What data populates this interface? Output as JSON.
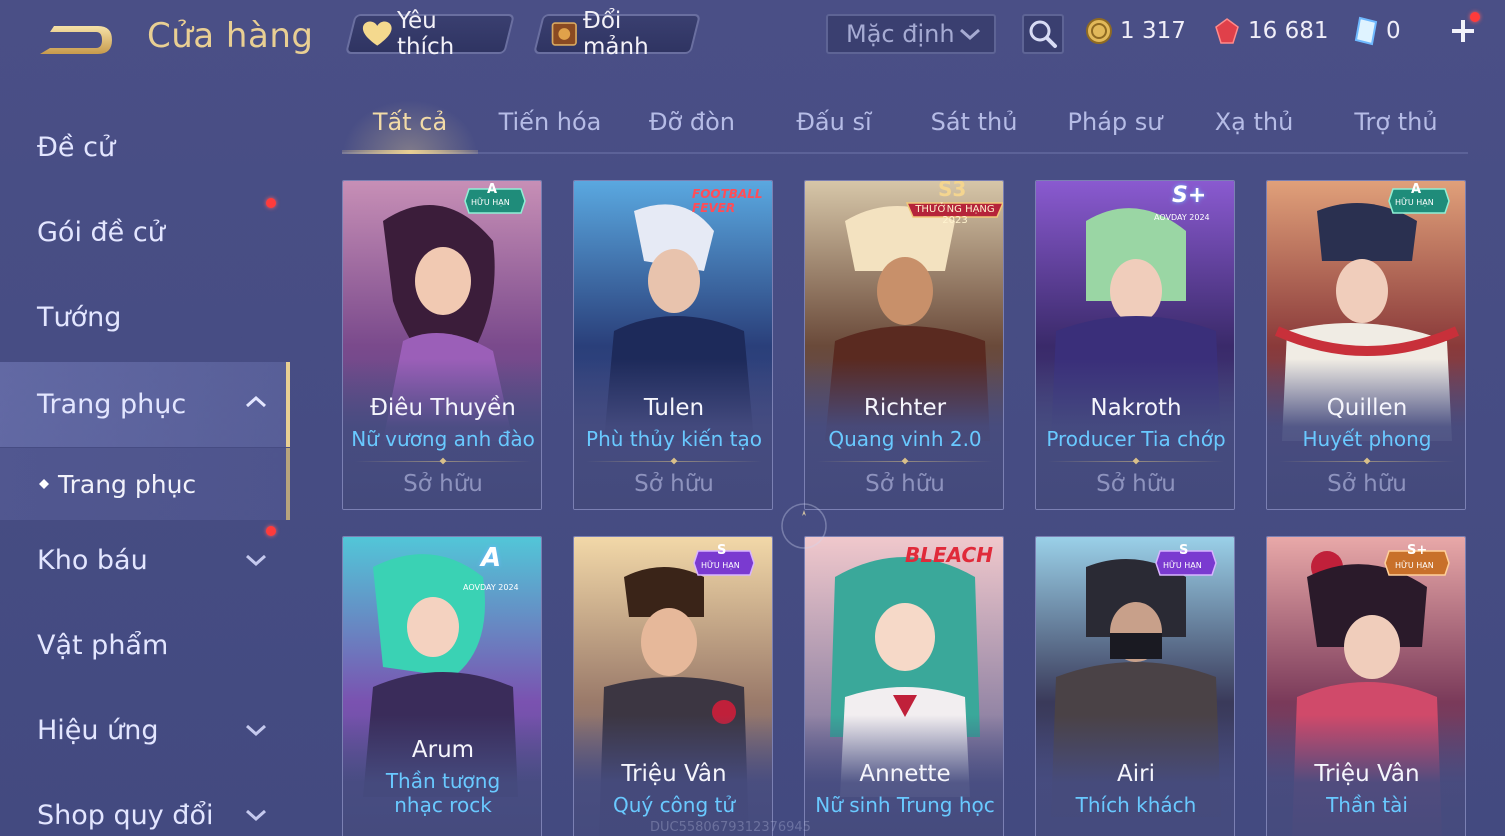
{
  "header": {
    "title": "Cửa hàng",
    "favorites_label": "Yêu thích",
    "fragments_label": "Đổi mảnh",
    "sort_label": "Mặc định"
  },
  "currency": {
    "coins": "1 317",
    "gems": "16 681",
    "vouchers": "0"
  },
  "sidebar": {
    "items": [
      {
        "label": "Đề cử"
      },
      {
        "label": "Gói đề cử"
      },
      {
        "label": "Tướng"
      },
      {
        "label": "Trang phục"
      },
      {
        "label": "Kho báu"
      },
      {
        "label": "Vật phẩm"
      },
      {
        "label": "Hiệu ứng"
      },
      {
        "label": "Shop quy đổi"
      }
    ],
    "sub_item": "Trang phục"
  },
  "tabs": [
    "Tất cả",
    "Tiến hóa",
    "Đỡ đòn",
    "Đấu sĩ",
    "Sát thủ",
    "Pháp sư",
    "Xạ thủ",
    "Trợ thủ"
  ],
  "cards": [
    {
      "hero": "Điêu Thuyền",
      "skin": "Nữ vương anh đào",
      "status": "Sở hữu",
      "badge": "A",
      "badge_sub": "HỮU HẠN"
    },
    {
      "hero": "Tulen",
      "skin": "Phù thủy kiến tạo",
      "status": "Sở hữu",
      "badge": "FOOTBALL FEVER",
      "badge_sub": ""
    },
    {
      "hero": "Richter",
      "skin": "Quang vinh 2.0",
      "status": "Sở hữu",
      "badge": "S3",
      "badge_sub": "THƯỞNG HẠNG 2023"
    },
    {
      "hero": "Nakroth",
      "skin": "Producer Tia chớp",
      "status": "Sở hữu",
      "badge": "S+",
      "badge_sub": "AOVDAY 2024"
    },
    {
      "hero": "Quillen",
      "skin": "Huyết phong",
      "status": "Sở hữu",
      "badge": "A",
      "badge_sub": "HỮU HẠN"
    },
    {
      "hero": "Arum",
      "skin": "Thần tượng nhạc rock",
      "status": "",
      "badge": "A",
      "badge_sub": "AOVDAY 2024"
    },
    {
      "hero": "Triệu Vân",
      "skin": "Quý công tử",
      "status": "",
      "badge": "S",
      "badge_sub": "HỮU HẠN"
    },
    {
      "hero": "Annette",
      "skin": "Nữ sinh Trung học",
      "status": "",
      "badge": "BLEACH",
      "badge_sub": ""
    },
    {
      "hero": "Airi",
      "skin": "Thích khách",
      "status": "",
      "badge": "S",
      "badge_sub": "HỮU HẠN"
    },
    {
      "hero": "Triệu Vân",
      "skin": "Thần tài",
      "status": "",
      "badge": "S+",
      "badge_sub": "HỮU HẠN"
    }
  ],
  "watermark": "DUC5580679312376945",
  "colors": {
    "gold": "#e8cf93",
    "skin_text": "#69c9ff",
    "background": "#474d84",
    "notify": "#ff3b3b"
  }
}
